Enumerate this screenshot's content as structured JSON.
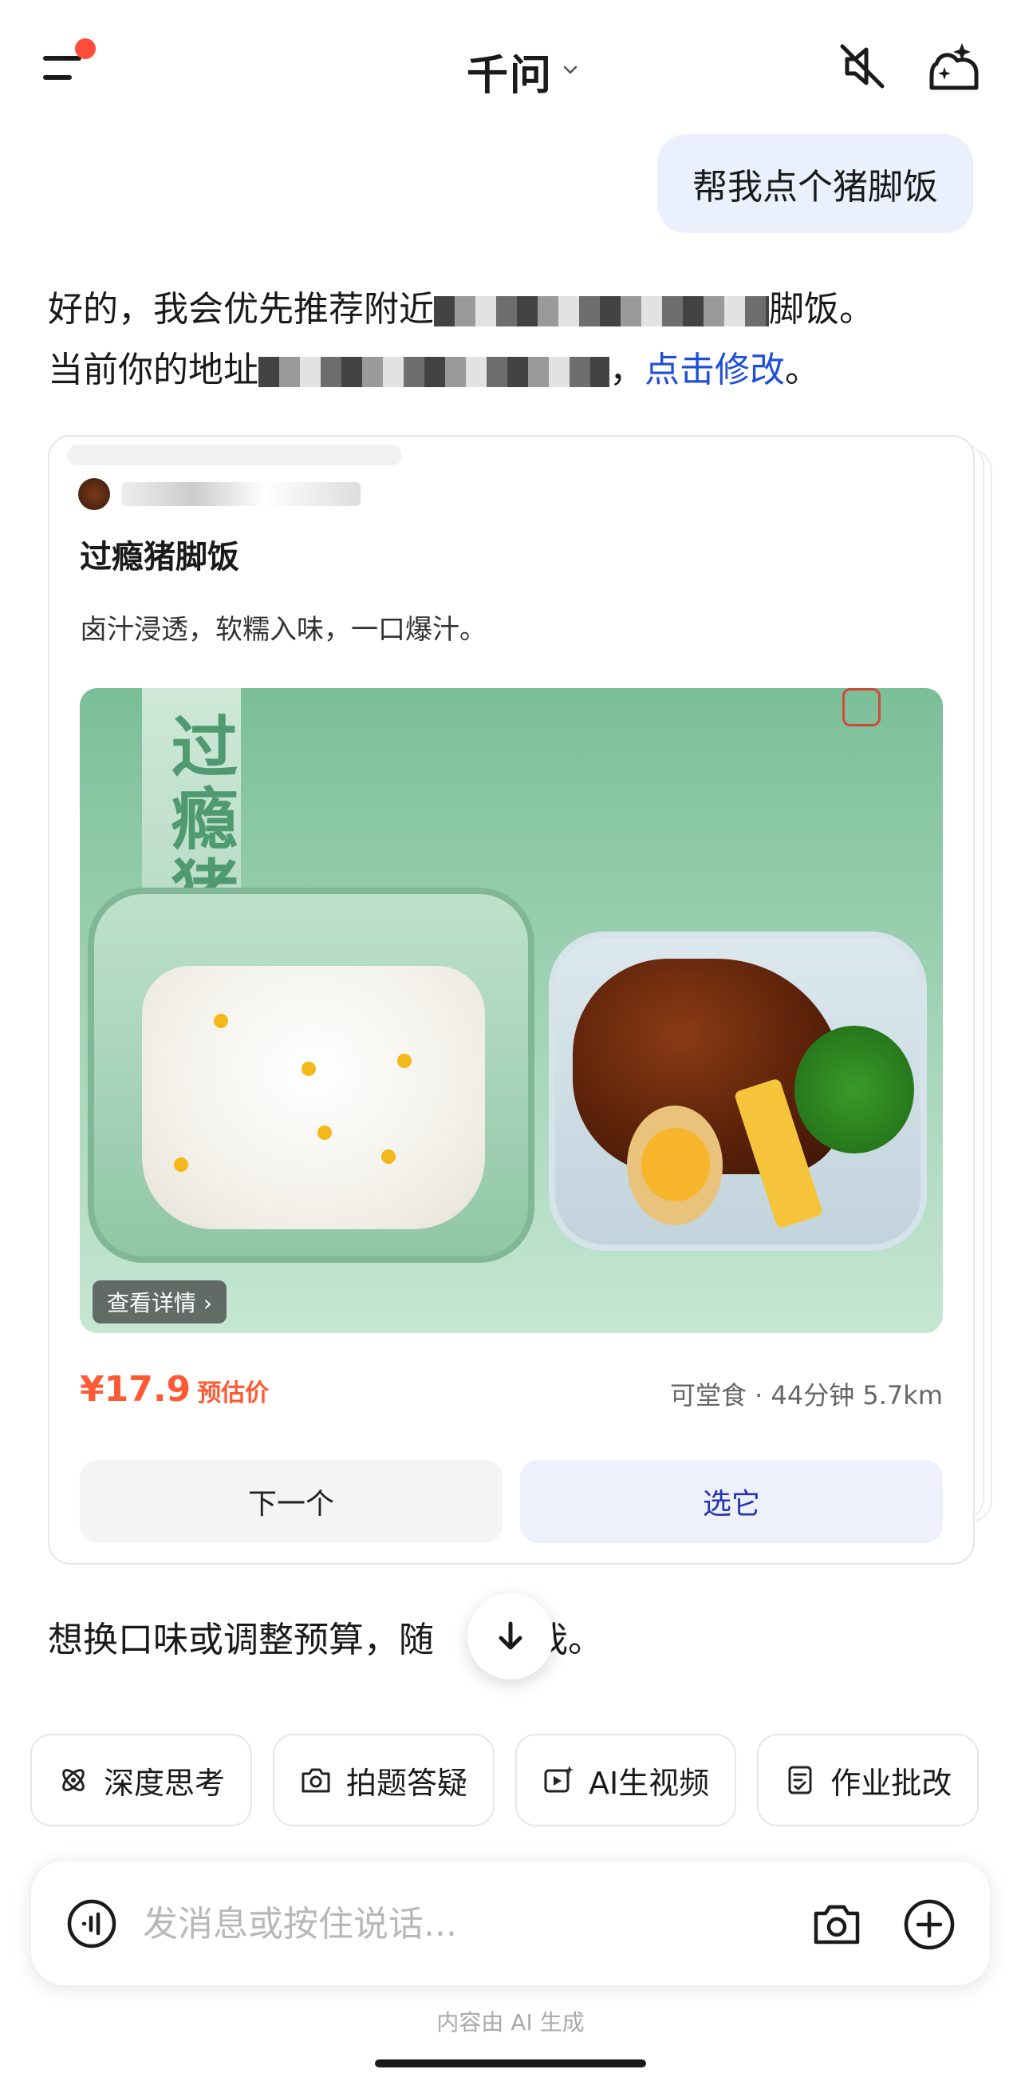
{
  "header": {
    "title": "千问",
    "notification_dot": true
  },
  "conversation": {
    "user_message": "帮我点个猪脚饭",
    "assistant_line1_start": "好的，我会优先推荐附近",
    "assistant_line1_end": "脚饭。",
    "assistant_line2_start": "当前你的地址",
    "assistant_line2_sep": "，",
    "change_link": "点击修改",
    "assistant_line2_end": "。"
  },
  "recommendation": {
    "dish_name": "过瘾猪脚饭",
    "description": "卤汁浸透，软糯入味，一口爆汁。",
    "banner_text": "过瘾猪脚饭",
    "detail_button": "查看详情 ›",
    "price": "¥17.9",
    "price_label": "预估价",
    "meta": "可堂食 · 44分钟 5.7km",
    "next_button": "下一个",
    "pick_button": "选它"
  },
  "followup": {
    "text_start": "想换口味或调整预算，随",
    "text_end": "诉我。"
  },
  "chips": [
    {
      "label": "深度思考",
      "icon": "deep-think-icon"
    },
    {
      "label": "拍题答疑",
      "icon": "photo-question-icon"
    },
    {
      "label": "AI生视频",
      "icon": "ai-video-icon"
    },
    {
      "label": "作业批改",
      "icon": "homework-icon"
    }
  ],
  "input": {
    "placeholder": "发消息或按住说话..."
  },
  "footer_note": "内容由 AI 生成",
  "colors": {
    "accent_blue": "#1f4fd8",
    "price_orange": "#ff5a33",
    "user_bubble": "#eaf1fd",
    "notification": "#ff4d3a"
  }
}
